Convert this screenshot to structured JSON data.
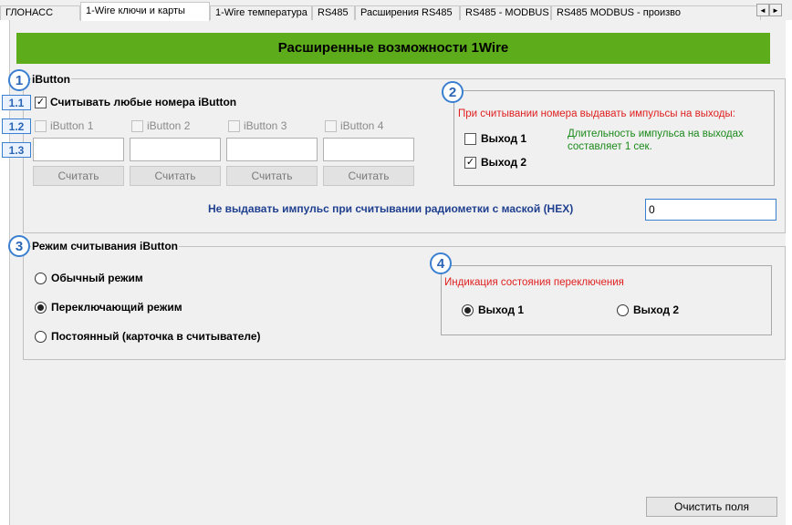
{
  "tabs": [
    {
      "label": "ГЛОНАСС"
    },
    {
      "label": "1-Wire ключи и карты"
    },
    {
      "label": "1-Wire температура"
    },
    {
      "label": "RS485"
    },
    {
      "label": "Расширения RS485"
    },
    {
      "label": "RS485 - MODBUS"
    },
    {
      "label": "RS485 MODBUS - произво"
    }
  ],
  "tab_scroll": {
    "left": "◄",
    "right": "►"
  },
  "banner": {
    "title": "Расширенные возможности 1Wire"
  },
  "markers": {
    "m1": "1",
    "m2": "2",
    "m3": "3",
    "m4": "4",
    "m11": "1.1",
    "m12": "1.2",
    "m13": "1.3"
  },
  "ibutton": {
    "group_label": "iButton",
    "read_any": {
      "label": "Считывать любые номера iButton",
      "checked": true,
      "mark": "✓"
    },
    "slots": [
      {
        "label": "iButton 1",
        "value": "",
        "button": "Считать"
      },
      {
        "label": "iButton 2",
        "value": "",
        "button": "Считать"
      },
      {
        "label": "iButton 3",
        "value": "",
        "button": "Считать"
      },
      {
        "label": "iButton 4",
        "value": "",
        "button": "Считать"
      }
    ],
    "mask_label": "Не выдавать импульс при считывании радиометки с маской (HEX)",
    "mask_value": "0"
  },
  "outputs": {
    "title": "При считывании номера выдавать импульсы на выходы:",
    "out1": {
      "label": "Выход 1",
      "checked": false
    },
    "out2": {
      "label": "Выход 2",
      "checked": true,
      "mark": "✓"
    },
    "note": "Длительность импульса на выходах составляет 1 сек."
  },
  "mode": {
    "group_label": "Режим считывания iButton",
    "options": [
      {
        "label": "Обычный режим",
        "selected": false
      },
      {
        "label": "Переключающий режим",
        "selected": true
      },
      {
        "label": "Постоянный (карточка в считывателе)",
        "selected": false
      }
    ]
  },
  "indication": {
    "title": "Индикация состояния переключения",
    "options": [
      {
        "label": "Выход 1",
        "selected": true
      },
      {
        "label": "Выход 2",
        "selected": false
      }
    ]
  },
  "clear_button": {
    "label": "Очистить поля"
  },
  "colors": {
    "banner": "#5cac1b",
    "marker": "#3a7fd0",
    "red_text": "#e02020",
    "green_text": "#1a8a1a"
  }
}
